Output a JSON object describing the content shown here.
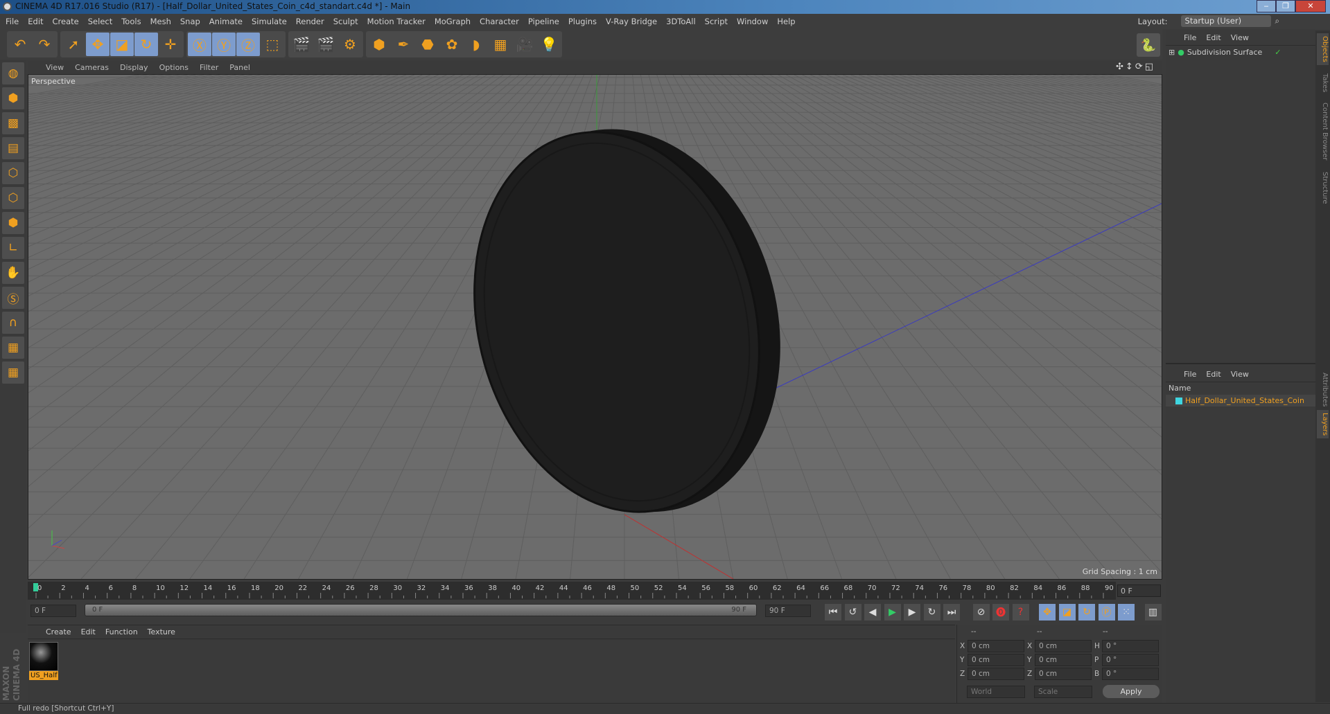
{
  "window": {
    "title": "CINEMA 4D R17.016 Studio (R17) - [Half_Dollar_United_States_Coin_c4d_standart.c4d *] - Main",
    "minimize": "‒",
    "restore": "❐",
    "close": "✕"
  },
  "menu": [
    "File",
    "Edit",
    "Create",
    "Select",
    "Tools",
    "Mesh",
    "Snap",
    "Animate",
    "Simulate",
    "Render",
    "Sculpt",
    "Motion Tracker",
    "MoGraph",
    "Character",
    "Pipeline",
    "Plugins",
    "V-Ray Bridge",
    "3DToAll",
    "Script",
    "Window",
    "Help"
  ],
  "layout": {
    "label": "Layout:",
    "value": "Startup (User)"
  },
  "toolbar": [
    {
      "icon": "undo-icon",
      "glyph": "↶"
    },
    {
      "icon": "redo-icon",
      "glyph": "↷"
    },
    {
      "icon": "select-icon",
      "glyph": "➚"
    },
    {
      "icon": "move-icon",
      "glyph": "✥",
      "active": true
    },
    {
      "icon": "scale-icon",
      "glyph": "◪",
      "active": true
    },
    {
      "icon": "rotate-icon",
      "glyph": "↻",
      "active": true
    },
    {
      "icon": "transform-icon",
      "glyph": "✛"
    },
    {
      "icon": "x-axis-icon",
      "glyph": "Ⓧ",
      "active": true
    },
    {
      "icon": "y-axis-icon",
      "glyph": "Ⓨ",
      "active": true
    },
    {
      "icon": "z-axis-icon",
      "glyph": "Ⓩ",
      "active": true
    },
    {
      "icon": "coord-system-icon",
      "glyph": "⬚"
    },
    {
      "icon": "render-view-icon",
      "glyph": "🎬"
    },
    {
      "icon": "render-picture-viewer-icon",
      "glyph": "🎬"
    },
    {
      "icon": "render-settings-icon",
      "glyph": "⚙"
    },
    {
      "icon": "cube-icon",
      "glyph": "⬢"
    },
    {
      "icon": "pen-icon",
      "glyph": "✒"
    },
    {
      "icon": "subdivision-icon",
      "glyph": "⬣"
    },
    {
      "icon": "mograph-icon",
      "glyph": "✿"
    },
    {
      "icon": "deformer-icon",
      "glyph": "◗"
    },
    {
      "icon": "floor-icon",
      "glyph": "▦"
    },
    {
      "icon": "camera-icon",
      "glyph": "🎥"
    },
    {
      "icon": "light-icon",
      "glyph": "💡"
    }
  ],
  "left_tools": [
    {
      "icon": "make-editable-icon",
      "glyph": "◍"
    },
    {
      "icon": "model-mode-icon",
      "glyph": "⬢"
    },
    {
      "icon": "texture-mode-icon",
      "glyph": "▩"
    },
    {
      "icon": "workplane-icon",
      "glyph": "▤"
    },
    {
      "icon": "points-mode-icon",
      "glyph": "⬡"
    },
    {
      "icon": "edges-mode-icon",
      "glyph": "⬡"
    },
    {
      "icon": "polygons-mode-icon",
      "glyph": "⬢"
    },
    {
      "icon": "axis-icon",
      "glyph": "∟"
    },
    {
      "icon": "tweak-icon",
      "glyph": "✋"
    },
    {
      "icon": "snap-icon",
      "glyph": "Ⓢ"
    },
    {
      "icon": "magnet-icon",
      "glyph": "∩"
    },
    {
      "icon": "lock-grid-icon",
      "glyph": "▦"
    },
    {
      "icon": "grid-snap-icon",
      "glyph": "▦"
    }
  ],
  "viewport": {
    "menu": [
      "View",
      "Cameras",
      "Display",
      "Options",
      "Filter",
      "Panel"
    ],
    "label": "Perspective",
    "grid_spacing": "Grid Spacing : 1 cm",
    "nav_icons": [
      "✣",
      "↕",
      "⟳",
      "◱"
    ]
  },
  "timeline": {
    "start": 0,
    "end": 90,
    "step": 2,
    "current": "0 F"
  },
  "transport": {
    "start_field": "0 F",
    "slider_start": "0 F",
    "slider_end": "90 F",
    "end_field": "90 F",
    "buttons": [
      {
        "icon": "go-start-icon",
        "glyph": "⏮"
      },
      {
        "icon": "prev-key-icon",
        "glyph": "↺"
      },
      {
        "icon": "prev-frame-icon",
        "glyph": "◀"
      },
      {
        "icon": "play-icon",
        "glyph": "▶"
      },
      {
        "icon": "next-frame-icon",
        "glyph": "▶"
      },
      {
        "icon": "next-key-icon",
        "glyph": "↻"
      },
      {
        "icon": "go-end-icon",
        "glyph": "⏭"
      },
      {
        "icon": "record-keys-icon",
        "glyph": "⊘"
      },
      {
        "icon": "autokey-icon",
        "glyph": "⓿"
      },
      {
        "icon": "keyframe-selection-icon",
        "glyph": "?"
      },
      {
        "icon": "key-position-icon",
        "glyph": "✥"
      },
      {
        "icon": "key-scale-icon",
        "glyph": "◪"
      },
      {
        "icon": "key-rotation-icon",
        "glyph": "↻"
      },
      {
        "icon": "key-param-icon",
        "glyph": "Ⓟ"
      },
      {
        "icon": "key-pla-icon",
        "glyph": "⁙"
      },
      {
        "icon": "timeline-icon",
        "glyph": "▥"
      }
    ]
  },
  "material": {
    "menu": [
      "Create",
      "Edit",
      "Function",
      "Texture"
    ],
    "name": "US_Half"
  },
  "coords": {
    "header": [
      "--",
      "--",
      "--"
    ],
    "rows": [
      [
        "X",
        "0 cm",
        "X",
        "0 cm",
        "H",
        "0 °"
      ],
      [
        "Y",
        "0 cm",
        "Y",
        "0 cm",
        "P",
        "0 °"
      ],
      [
        "Z",
        "0 cm",
        "Z",
        "0 cm",
        "B",
        "0 °"
      ]
    ],
    "mode": "World",
    "size_mode": "Scale",
    "apply": "Apply"
  },
  "objects": {
    "menu": [
      "File",
      "Edit",
      "View"
    ],
    "items": [
      {
        "name": "Subdivision Surface"
      }
    ]
  },
  "layers": {
    "menu": [
      "File",
      "Edit",
      "View"
    ],
    "header": "Name",
    "items": [
      {
        "name": "Half_Dollar_United_States_Coin",
        "color": "#3fd6e0"
      }
    ]
  },
  "side_tabs": [
    "Objects",
    "Takes",
    "Content Browser",
    "Structure",
    "Attributes",
    "Layers"
  ],
  "status": "Full redo [Shortcut Ctrl+Y]",
  "brand": "MAXON CINEMA 4D",
  "colors": {
    "accent": "#f0a020",
    "active_tool": "#7d9ccd",
    "coin": "#1e1e1e"
  }
}
